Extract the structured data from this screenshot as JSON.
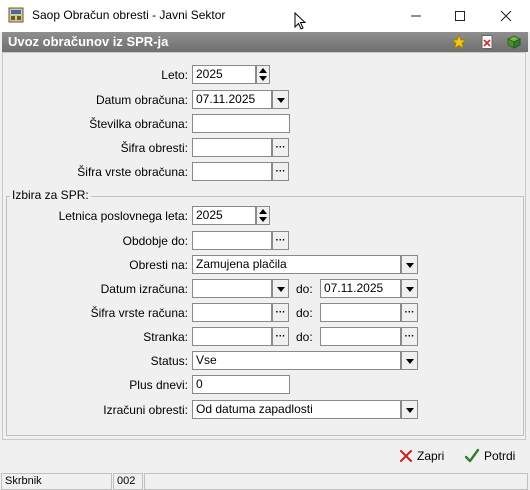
{
  "window": {
    "title": "Saop Obračun obresti - Javni Sektor"
  },
  "header": {
    "title": "Uvoz obračunov iz SPR-ja"
  },
  "form": {
    "leto": {
      "label": "Leto:",
      "value": "2025"
    },
    "datum_obracuna": {
      "label": "Datum obračuna:",
      "value": "07.11.2025"
    },
    "stevilka_obracuna": {
      "label": "Številka obračuna:",
      "value": ""
    },
    "sifra_obresti": {
      "label": "Šifra obresti:",
      "value": ""
    },
    "sifra_vrste_obracuna": {
      "label": "Šifra vrste obračuna:",
      "value": ""
    }
  },
  "spr": {
    "group_title": "Izbira za SPR:",
    "letnica": {
      "label": "Letnica poslovnega leta:",
      "value": "2025"
    },
    "obdobje_do": {
      "label": "Obdobje do:",
      "value": ""
    },
    "obresti_na": {
      "label": "Obresti na:",
      "value": "Zamujena plačila"
    },
    "datum_izracuna": {
      "label": "Datum izračuna:",
      "from": "",
      "do_label": "do:",
      "to": "07.11.2025"
    },
    "sifra_vrste_racuna": {
      "label": "Šifra vrste računa:",
      "from": "",
      "do_label": "do:",
      "to": ""
    },
    "stranka": {
      "label": "Stranka:",
      "from": "",
      "do_label": "do:",
      "to": ""
    },
    "status": {
      "label": "Status:",
      "value": "Vse"
    },
    "plus_dnevi": {
      "label": "Plus dnevi:",
      "value": "0"
    },
    "izracuni_obresti": {
      "label": "Izračuni obresti:",
      "value": "Od datuma zapadlosti"
    }
  },
  "actions": {
    "close": "Zapri",
    "confirm": "Potrdi"
  },
  "statusbar": {
    "user": "Skrbnik",
    "code": "002",
    "extra": ""
  },
  "colors": {
    "close_icon": "#c62828",
    "confirm_icon": "#2e7d32",
    "header_bg": "#7f7f7f"
  }
}
